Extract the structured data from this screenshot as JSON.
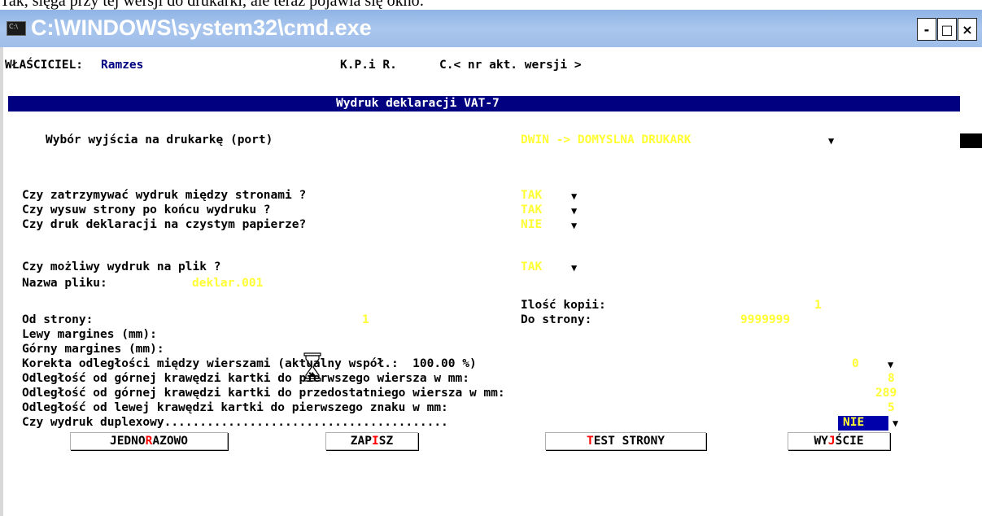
{
  "page_header_text": "Tak, sięga przy tej wersji do drukarki, ale teraz pojawia się okno:",
  "window": {
    "title": "C:\\WINDOWS\\system32\\cmd.exe",
    "icon": "console-icon",
    "minimize": "-",
    "maximize": "□",
    "close": "×"
  },
  "header": {
    "owner_label": "WŁAŚCICIEL:",
    "owner_value": "Ramzes",
    "module": "K.P.i R.",
    "version": "C.< nr akt. wersji >"
  },
  "banner": {
    "title": "Wydruk deklaracji VAT-7"
  },
  "printer": {
    "label": "Wybór wyjścia na drukarkę (port)",
    "value": "DWIN -> DOMYSLNA DRUKARK"
  },
  "options": [
    {
      "label": "Czy zatrzymywać wydruk między stronami ?",
      "value": "TAK"
    },
    {
      "label": "Czy wysuw strony po końcu wydruku ?",
      "value": "TAK"
    },
    {
      "label": "Czy druk deklaracji na czystym papierze?",
      "value": "NIE"
    }
  ],
  "file_print": {
    "label": "Czy możliwy wydruk na plik ?",
    "value": "TAK"
  },
  "file_name": {
    "label": "Nazwa pliku:",
    "value": "deklar.001"
  },
  "copies": {
    "label": "Ilość kopii:",
    "value": "1"
  },
  "from_page": {
    "label": "Od strony:",
    "value": "1"
  },
  "to_page": {
    "label": "Do strony:",
    "value": "9999999"
  },
  "left_margin": {
    "label": "Lewy margines (mm):"
  },
  "top_margin": {
    "label": "Górny margines (mm):"
  },
  "line_correction": {
    "label": "Korekta odległości między wierszami (aktualny współ.:  100.00 %)",
    "value": "0"
  },
  "top_edge": {
    "label": "Odległość od górnej krawędzi kartki do pierwszego wiersza w mm:",
    "value": "8"
  },
  "pre_last": {
    "label": "Odległość od górnej krawędzi kartki do przedostatniego wiersza w mm:",
    "value": "289"
  },
  "left_edge": {
    "label": "Odległość od lewej krawędzi kartki do pierwszego znaku w mm:",
    "value": "5"
  },
  "duplex": {
    "label": "Czy wydruk duplexowy........................................",
    "value": "NIE"
  },
  "buttons": {
    "once": {
      "pre": "JEDNO",
      "hot": "R",
      "post": "AZOWO"
    },
    "save": {
      "pre": "ZAP",
      "hot": "I",
      "post": "SZ"
    },
    "test": {
      "pre": "",
      "hot": "T",
      "post": "EST STRONY"
    },
    "exit": {
      "pre": "WY",
      "hot": "J",
      "post": "ŚCIE"
    }
  },
  "dropdown_glyph": "▼",
  "colors": {
    "yellow": "#ffff33",
    "banner": "#000080",
    "hotkey": "#ff0000"
  }
}
